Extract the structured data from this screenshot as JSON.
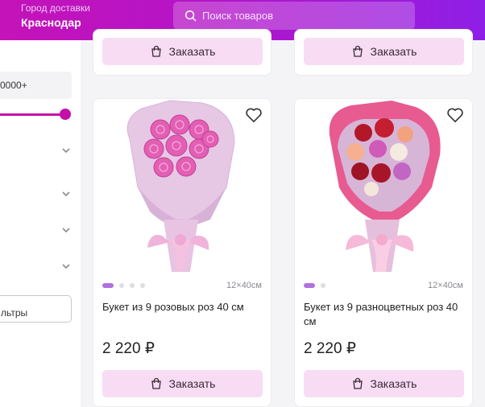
{
  "header": {
    "city_caption": "Город доставки",
    "city_name": "Краснодар",
    "search_placeholder": "Поиск товаров"
  },
  "sidebar": {
    "price_max": "0000+",
    "filters_button": "льтры"
  },
  "top_cards": [
    {
      "order_label": "Заказать"
    },
    {
      "order_label": "Заказать"
    }
  ],
  "products": [
    {
      "title": "Букет из 9 розовых роз 40 см",
      "price": "2 220 ₽",
      "size": "12×40см",
      "order_label": "Заказать",
      "image_dots": 4
    },
    {
      "title": "Букет из 9 разноцветных роз 40 см",
      "price": "2 220 ₽",
      "size": "12×40см",
      "order_label": "Заказать",
      "image_dots": 2
    }
  ],
  "colors": {
    "header_start": "#c413b8",
    "header_end": "#8f1fe6",
    "accent": "#c60fa9",
    "button_bg": "#f8dcf4"
  }
}
